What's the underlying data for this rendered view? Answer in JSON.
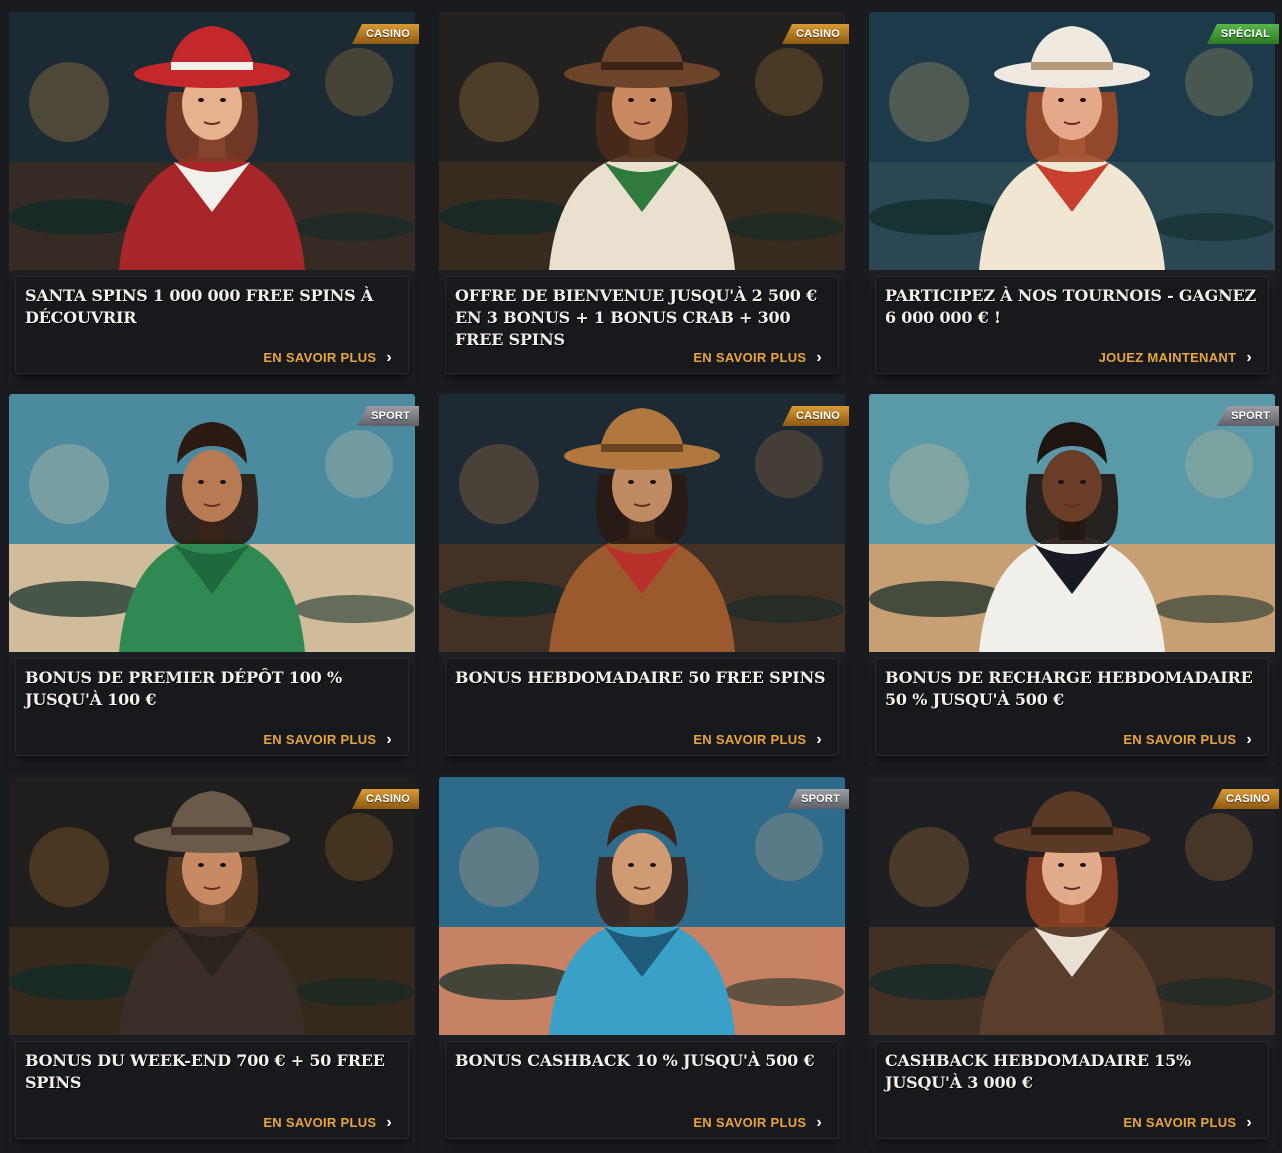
{
  "promotions": [
    {
      "tag": "CASINO",
      "tag_type": "casino",
      "title": "SANTA SPINS 1 000 000 FREE SPINS À DÉCOUVRIR",
      "cta": "EN SAVOIR PLUS",
      "scene": "santa-cowgirl"
    },
    {
      "tag": "CASINO",
      "tag_type": "casino",
      "title": "OFFRE DE BIENVENUE JUSQU'À 2 500 € EN 3 BONUS + 1 BONUS CRAB + 300 FREE SPINS",
      "cta": "EN SAVOIR PLUS",
      "scene": "cowboy-green-scarf"
    },
    {
      "tag": "SPÉCIAL",
      "tag_type": "special",
      "title": "PARTICIPEZ À NOS TOURNOIS - GAGNEZ 6 000 000 € !",
      "cta": "JOUEZ MAINTENANT",
      "scene": "cowgirl-revolvers"
    },
    {
      "tag": "SPORT",
      "tag_type": "sport",
      "title": "BONUS DE PREMIER DÉPÔT 100 % JUSQU'À 100 €",
      "cta": "EN SAVOIR PLUS",
      "scene": "soccer-player-green"
    },
    {
      "tag": "CASINO",
      "tag_type": "casino",
      "title": "BONUS HEBDOMADAIRE 50 FREE SPINS",
      "cta": "EN SAVOIR PLUS",
      "scene": "masked-bandit"
    },
    {
      "tag": "SPORT",
      "tag_type": "sport",
      "title": "BONUS DE RECHARGE HEBDOMADAIRE 50 % JUSQU'À 500 €",
      "cta": "EN SAVOIR PLUS",
      "scene": "basketball-player"
    },
    {
      "tag": "CASINO",
      "tag_type": "casino",
      "title": "BONUS DU WEEK-END 700 € + 50 FREE SPINS",
      "cta": "EN SAVOIR PLUS",
      "scene": "bearded-cowboy"
    },
    {
      "tag": "SPORT",
      "tag_type": "sport",
      "title": "BONUS CASHBACK 10 % JUSQU'À 500 €",
      "cta": "EN SAVOIR PLUS",
      "scene": "soccer-player-blue"
    },
    {
      "tag": "CASINO",
      "tag_type": "casino",
      "title": "CASHBACK HEBDOMADAIRE 15% JUSQU'À 3 000 €",
      "cta": "EN SAVOIR PLUS",
      "scene": "cowgirl-pistol"
    }
  ],
  "colors": {
    "background": "#1a1b1f",
    "card_body": "#18191d",
    "cta": "#e8a53a",
    "casino_tag": "#c88a2a",
    "sport_tag": "#8a8d93",
    "special_tag": "#4aa83d"
  }
}
